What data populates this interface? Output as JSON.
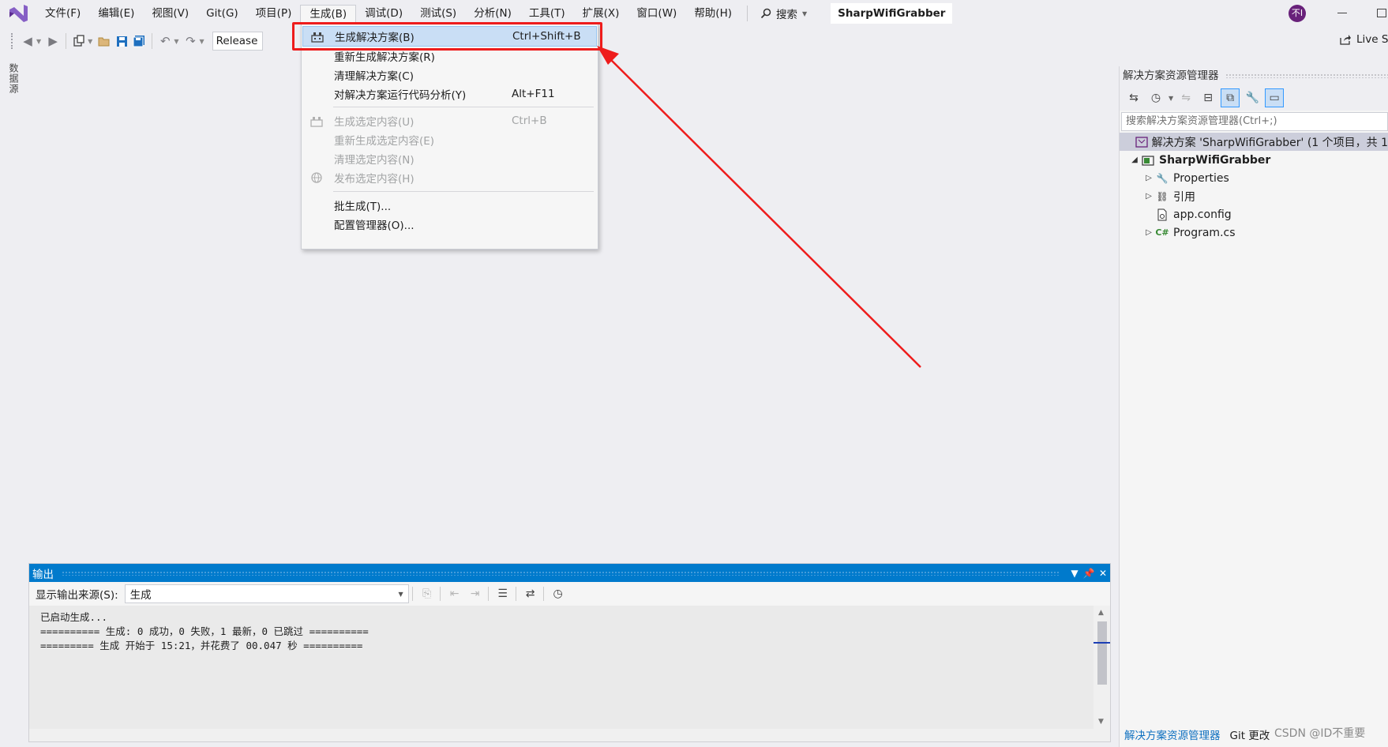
{
  "app": {
    "solution_name": "SharpWifiGrabber",
    "avatar_text": "不I",
    "search_label": "搜索"
  },
  "menu": [
    "文件(F)",
    "编辑(E)",
    "视图(V)",
    "Git(G)",
    "项目(P)",
    "生成(B)",
    "调试(D)",
    "测试(S)",
    "分析(N)",
    "工具(T)",
    "扩展(X)",
    "窗口(W)",
    "帮助(H)"
  ],
  "toolbar": {
    "config": "Release",
    "live_share": "Live S"
  },
  "left_tab": "数据源",
  "build_menu": {
    "items": [
      {
        "label": "生成解决方案(B)",
        "shortcut": "Ctrl+Shift+B"
      },
      {
        "label": "重新生成解决方案(R)",
        "shortcut": ""
      },
      {
        "label": "清理解决方案(C)",
        "shortcut": ""
      },
      {
        "label": "对解决方案运行代码分析(Y)",
        "shortcut": "Alt+F11"
      },
      {
        "label": "生成选定内容(U)",
        "shortcut": "Ctrl+B"
      },
      {
        "label": "重新生成选定内容(E)",
        "shortcut": ""
      },
      {
        "label": "清理选定内容(N)",
        "shortcut": ""
      },
      {
        "label": "发布选定内容(H)",
        "shortcut": ""
      },
      {
        "label": "批生成(T)...",
        "shortcut": ""
      },
      {
        "label": "配置管理器(O)...",
        "shortcut": ""
      }
    ]
  },
  "solution_explorer": {
    "title": "解决方案资源管理器",
    "search_placeholder": "搜索解决方案资源管理器(Ctrl+;)",
    "solution_row": "解决方案 'SharpWifiGrabber' (1 个项目，共 1",
    "project": "SharpWifiGrabber",
    "children": [
      "Properties",
      "引用",
      "app.config",
      "Program.cs"
    ],
    "bottom_tabs": [
      "解决方案资源管理器",
      "Git 更改"
    ]
  },
  "output": {
    "title": "输出",
    "source_label": "显示输出来源(S):",
    "source_value": "生成",
    "lines": [
      "已启动生成...",
      "========== 生成: 0 成功，0 失败，1 最新，0 已跳过 ==========",
      "========= 生成 开始于 15:21，并花费了 00.047 秒 =========="
    ]
  },
  "watermark": "CSDN @ID不重要",
  "colors": {
    "accent": "#007acc",
    "annotation": "#ee1c1c",
    "menu_highlight": "#c9def5",
    "vs_purple": "#68217a"
  }
}
